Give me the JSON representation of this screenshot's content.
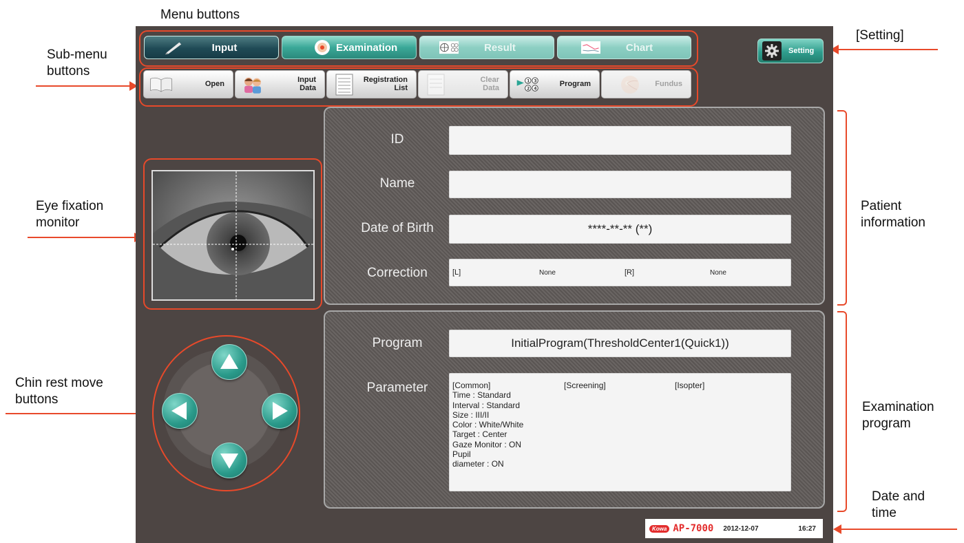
{
  "annotations": {
    "menu_buttons": "Menu buttons",
    "sub_menu_buttons": "Sub-menu\nbuttons",
    "setting": "[Setting]",
    "eye_fixation_monitor": "Eye fixation\nmonitor",
    "patient_information": "Patient\ninformation",
    "chin_rest_move_buttons": "Chin rest move\nbuttons",
    "examination_program": "Examination\nprogram",
    "date_and_time": "Date and\ntime"
  },
  "menu": {
    "items": [
      {
        "label": "Input",
        "icon": "pen-icon",
        "state": "active"
      },
      {
        "label": "Examination",
        "icon": "target-icon",
        "state": "normal"
      },
      {
        "label": "Result",
        "icon": "grid-icon",
        "state": "disabled"
      },
      {
        "label": "Chart",
        "icon": "chart-icon",
        "state": "disabled"
      }
    ],
    "setting_label": "Setting"
  },
  "submenu": {
    "items": [
      {
        "label": "Open",
        "icon": "book-icon",
        "state": "normal"
      },
      {
        "label": "Input\nData",
        "icon": "people-icon",
        "state": "normal"
      },
      {
        "label": "Registration\nList",
        "icon": "list-icon",
        "state": "normal"
      },
      {
        "label": "Clear\nData",
        "icon": "clear-icon",
        "state": "disabled"
      },
      {
        "label": "Program",
        "icon": "program-icon",
        "state": "normal"
      },
      {
        "label": "Fundus",
        "icon": "fundus-icon",
        "state": "disabled"
      }
    ]
  },
  "patient": {
    "id_label": "ID",
    "id_value": "",
    "name_label": "Name",
    "name_value": "",
    "dob_label": "Date of Birth",
    "dob_value": "****-**-** (**)",
    "correction_label": "Correction",
    "correction_l": "[L]",
    "correction_l_value": "None",
    "correction_r": "[R]",
    "correction_r_value": "None"
  },
  "program": {
    "program_label": "Program",
    "program_value": "InitialProgram(ThresholdCenter1(Quick1))",
    "parameter_label": "Parameter",
    "common_header": "[Common]",
    "screening_header": "[Screening]",
    "isopter_header": "[Isopter]",
    "common_lines": [
      "Time : Standard",
      "Interval : Standard",
      "Size : III/II",
      "Color : White/White",
      "Target : Center",
      "Gaze Monitor : ON",
      "Pupil",
      "diameter : ON"
    ]
  },
  "status": {
    "brand": "Kowa",
    "model": "AP-7000",
    "date": "2012-12-07",
    "time": "16:27"
  },
  "colors": {
    "accent": "#e8492a",
    "teal": "#2a9a8a",
    "background": "#4d4543"
  }
}
